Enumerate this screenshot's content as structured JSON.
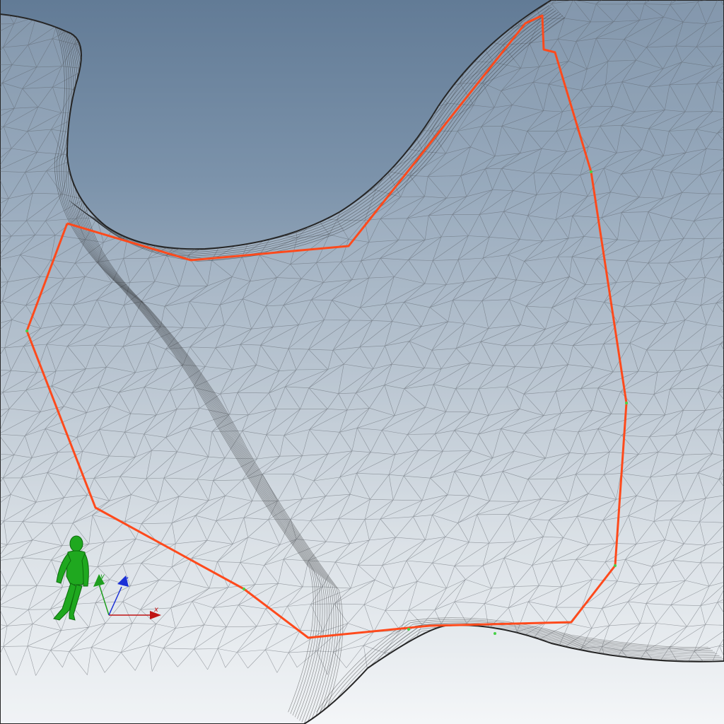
{
  "viewport": {
    "background_top": "#627b96",
    "background_bottom": "#f4f6f8",
    "mesh_color": "#2b2b2b",
    "mesh_light_color": "#f2f2f2",
    "path_color": "#ff4a1c",
    "path_vertex_color": "#47d147",
    "avatar_color": "#1fa81f"
  },
  "axes": {
    "x": {
      "label": "x",
      "color": "#c01414"
    },
    "y": {
      "label": "y",
      "color": "#1e9e1e"
    },
    "z": {
      "label": "z",
      "color": "#1a2fd6"
    }
  },
  "icons": {
    "avatar": "human-figure-icon",
    "gizmo": "axis-gizmo-icon"
  }
}
